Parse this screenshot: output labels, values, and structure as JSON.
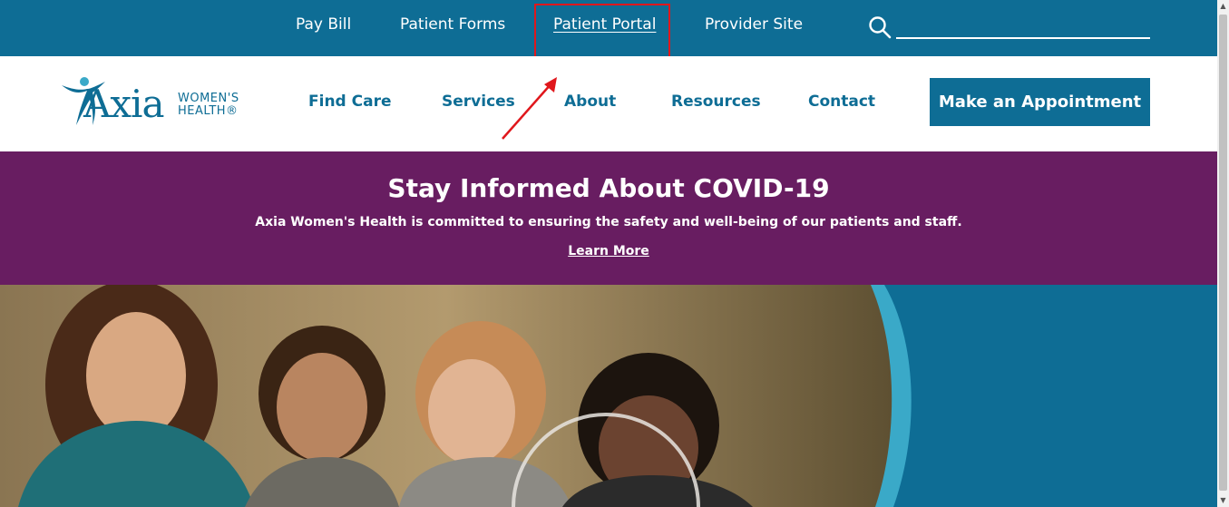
{
  "topbar": {
    "links": [
      {
        "label": "Pay Bill"
      },
      {
        "label": "Patient Forms"
      },
      {
        "label": "Patient Portal"
      },
      {
        "label": "Provider Site"
      }
    ],
    "search_placeholder": ""
  },
  "brand": {
    "name": "Axia",
    "subtitle_line1": "WOMEN'S",
    "subtitle_line2": "HEALTH®"
  },
  "nav": {
    "items": [
      {
        "label": "Find Care"
      },
      {
        "label": "Services"
      },
      {
        "label": "About"
      },
      {
        "label": "Resources"
      },
      {
        "label": "Contact"
      }
    ],
    "cta_label": "Make an Appointment"
  },
  "banner": {
    "title": "Stay Informed About COVID-19",
    "body": "Axia Women's Health is committed to ensuring the safety and well-being of our patients and staff.",
    "link_label": "Learn More"
  },
  "colors": {
    "brand_blue": "#0e6d95",
    "banner_purple": "#681d61",
    "highlight_red": "#e0171c",
    "accent_light_blue": "#3aa9c8"
  },
  "icons": {
    "search": "search-icon",
    "logo": "axia-figure-logo"
  }
}
